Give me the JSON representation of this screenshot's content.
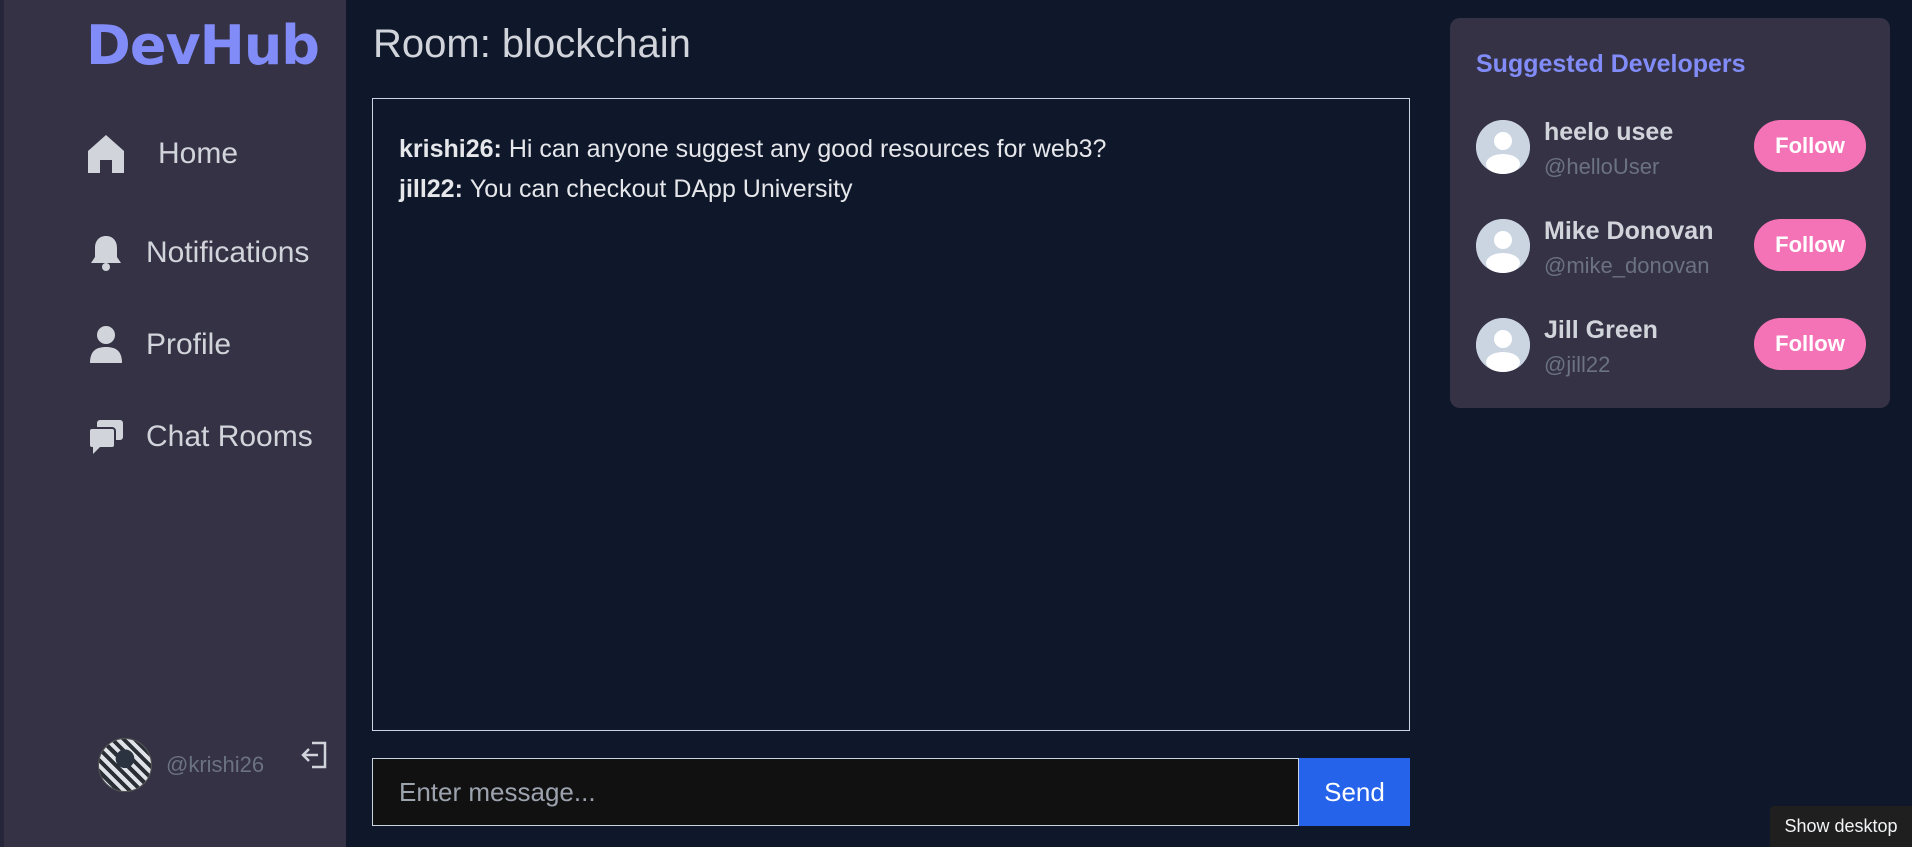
{
  "app": {
    "logo": "DevHub"
  },
  "sidebar": {
    "items": [
      {
        "label": "Home",
        "icon": "home-icon"
      },
      {
        "label": "Notifications",
        "icon": "bell-icon"
      },
      {
        "label": "Profile",
        "icon": "user-icon"
      },
      {
        "label": "Chat Rooms",
        "icon": "chat-icon"
      }
    ],
    "current_user": {
      "handle": "@krishi26"
    }
  },
  "room": {
    "title": "Room: blockchain",
    "messages": [
      {
        "user": "krishi26:",
        "text": "Hi can anyone suggest any good resources for web3?"
      },
      {
        "user": "jill22:",
        "text": "You can checkout DApp University"
      }
    ]
  },
  "composer": {
    "placeholder": "Enter message...",
    "send_label": "Send"
  },
  "suggested": {
    "title": "Suggested Developers",
    "developers": [
      {
        "name": "heelo usee",
        "handle": "@helloUser",
        "follow_label": "Follow"
      },
      {
        "name": "Mike Donovan",
        "handle": "@mike_donovan",
        "follow_label": "Follow"
      },
      {
        "name": "Jill Green",
        "handle": "@jill22",
        "follow_label": "Follow"
      }
    ]
  },
  "taskbar": {
    "show_desktop": "Show desktop"
  },
  "colors": {
    "accent": "#818cf8",
    "follow": "#f472b6",
    "send": "#2563eb",
    "background": "#0f172a",
    "panel": "#353245"
  }
}
